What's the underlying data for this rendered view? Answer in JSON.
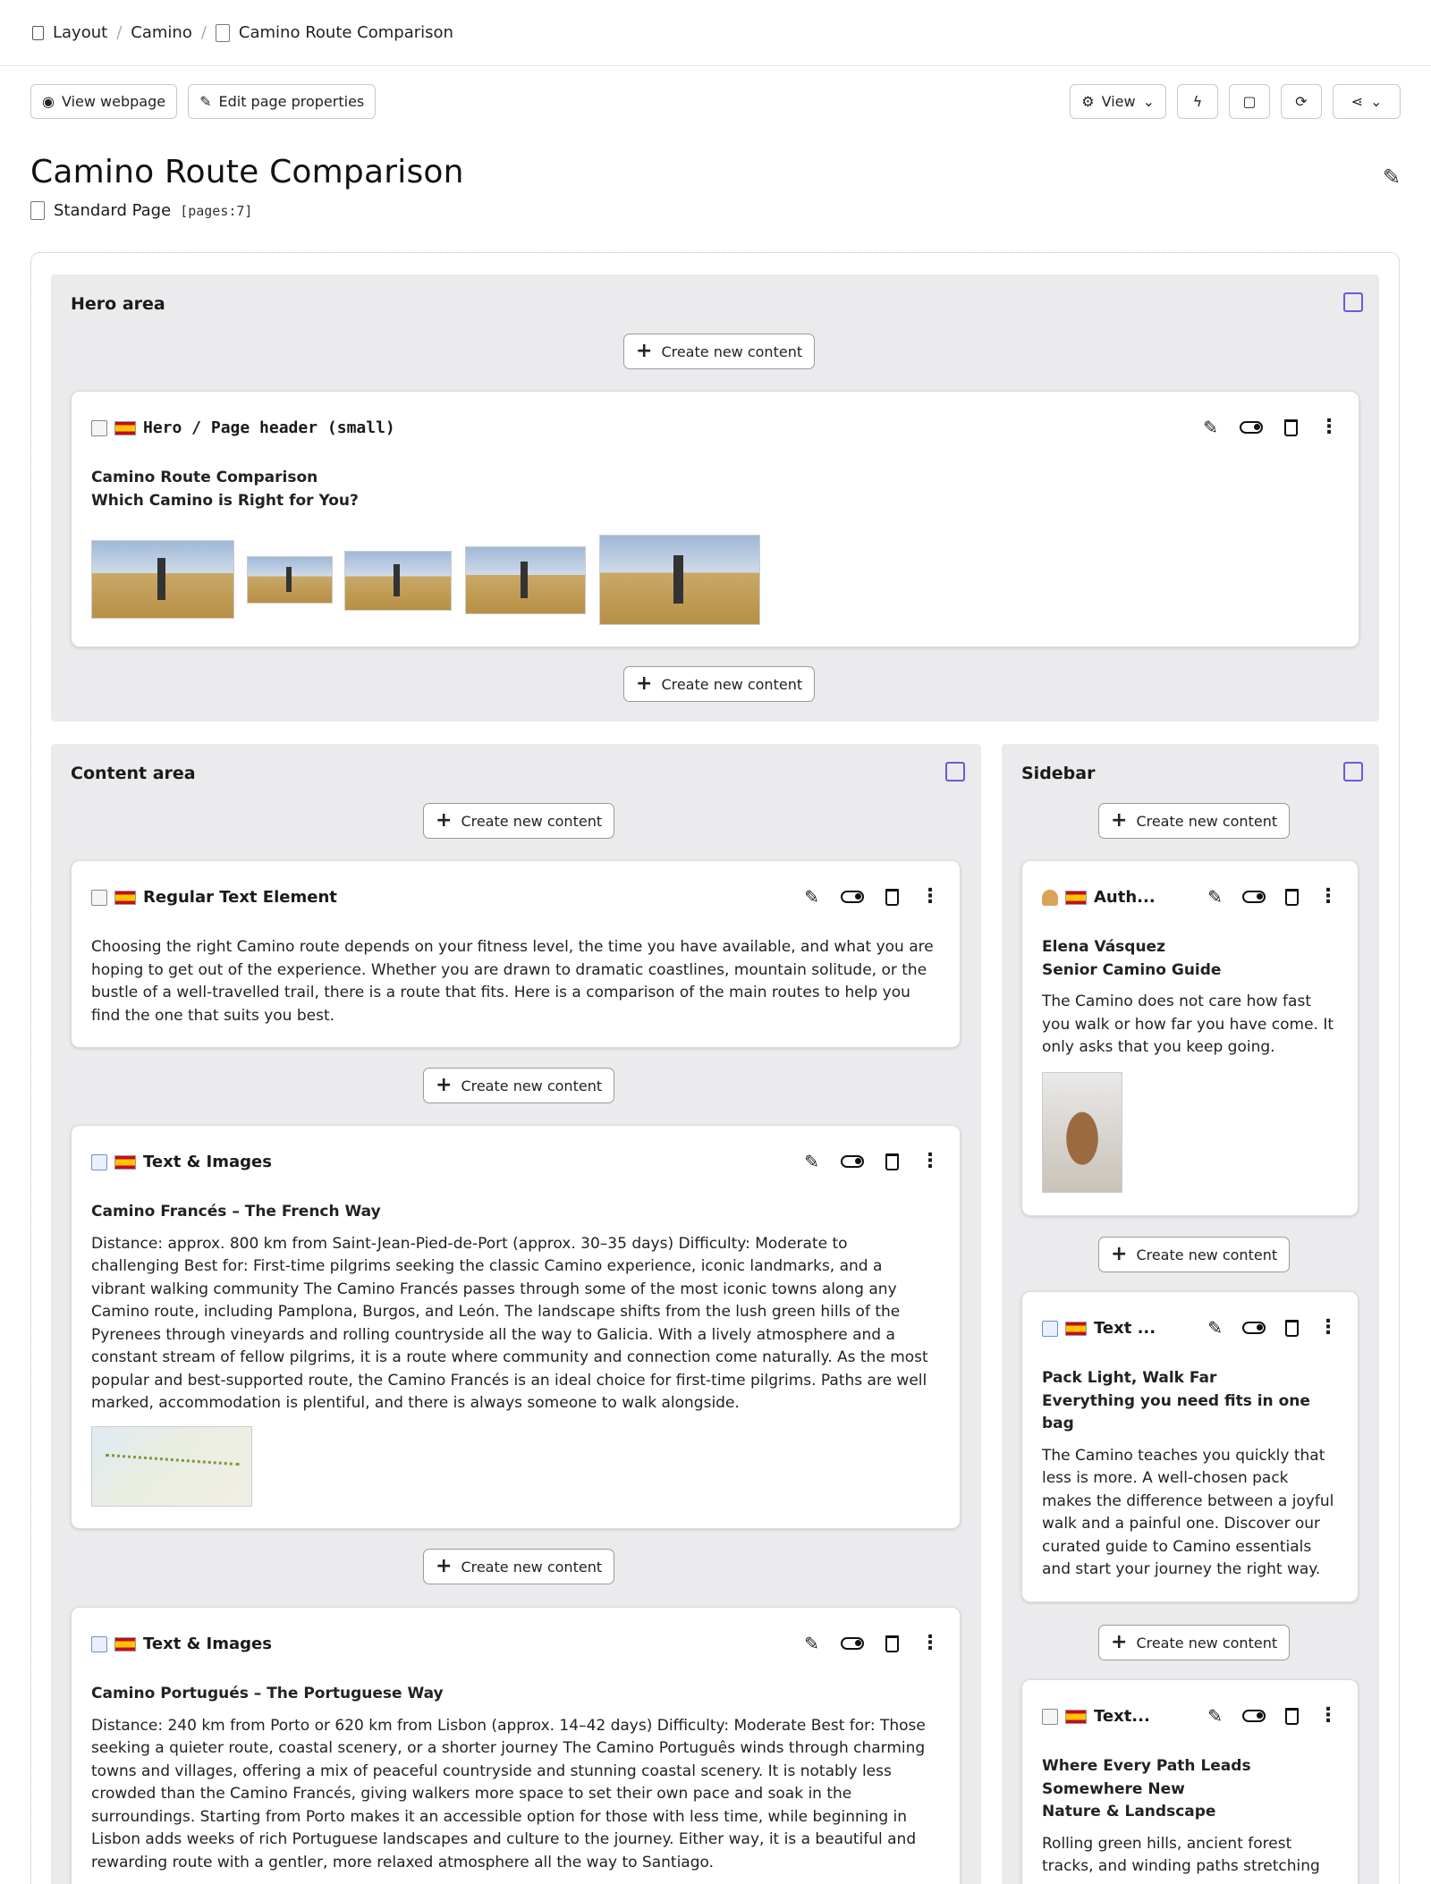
{
  "breadcrumb": {
    "items": [
      "Layout",
      "Camino",
      "Camino Route Comparison"
    ]
  },
  "toolbar": {
    "view_webpage": "View webpage",
    "edit_properties": "Edit page properties",
    "view": "View"
  },
  "page": {
    "title": "Camino Route Comparison",
    "type": "Standard Page",
    "id": "[pages:7]"
  },
  "create_label": "Create new content",
  "areas": {
    "hero": "Hero area",
    "content": "Content area",
    "sidebar": "Sidebar"
  },
  "hero_card": {
    "title": "Hero / Page header (small)",
    "heading": "Camino Route Comparison",
    "subheading": "Which Camino is Right for You?"
  },
  "content_cards": [
    {
      "title": "Regular Text Element",
      "body": "Choosing the right Camino route depends on your fitness level, the time you have available, and what you are hoping to get out of the experience. Whether you are drawn to dramatic coastlines, mountain solitude, or the bustle of a well-travelled trail, there is a route that fits. Here is a comparison of the main routes to help you find the one that suits you best."
    },
    {
      "title": "Text & Images",
      "heading": "Camino Francés – The French Way",
      "body": "Distance: approx. 800 km from Saint-Jean-Pied-de-Port (approx. 30–35 days) Difficulty: Moderate to challenging Best for: First-time pilgrims seeking the classic Camino experience, iconic landmarks, and a vibrant walking community The Camino Francés passes through some of the most iconic towns along any Camino route, including Pamplona, Burgos, and León. The landscape shifts from the lush green hills of the Pyrenees through vineyards and rolling countryside all the way to Galicia. With a lively atmosphere and a constant stream of fellow pilgrims, it is a route where community and connection come naturally. As the most popular and best-supported route, the Camino Francés is an ideal choice for first-time pilgrims. Paths are well marked, accommodation is plentiful, and there is always someone to walk alongside."
    },
    {
      "title": "Text & Images",
      "heading": "Camino Portugués – The Portuguese Way",
      "body": "Distance: 240 km from Porto or 620 km from Lisbon (approx. 14–42 days) Difficulty: Moderate Best for: Those seeking a quieter route, coastal scenery, or a shorter journey The Camino Português winds through charming towns and villages, offering a mix of peaceful countryside and stunning coastal scenery. It is notably less crowded than the Camino Francés, giving walkers more space to set their own pace and soak in the surroundings. Starting from Porto makes it an accessible option for those with less time, while beginning in Lisbon adds weeks of rich Portuguese landscapes and culture to the journey. Either way, it is a beautiful and rewarding route with a gentler, more relaxed atmosphere all the way to Santiago."
    }
  ],
  "sidebar_cards": [
    {
      "title": "Auth...",
      "name": "Elena Vásquez",
      "role": "Senior Camino Guide",
      "body": "The Camino does not care how fast you walk or how far you have come. It only asks that you keep going."
    },
    {
      "title": "Text ...",
      "heading": "Pack Light, Walk Far",
      "subheading": "Everything you need fits in one bag",
      "body": "The Camino teaches you quickly that less is more. A well-chosen pack makes the difference between a joyful walk and a painful one. Discover our curated guide to Camino essentials and start your journey the right way."
    },
    {
      "title": "Text...",
      "heading": "Where Every Path Leads Somewhere New",
      "subheading": "Nature & Landscape",
      "body": "Rolling green hills, ancient forest tracks, and winding paths stretching"
    }
  ]
}
